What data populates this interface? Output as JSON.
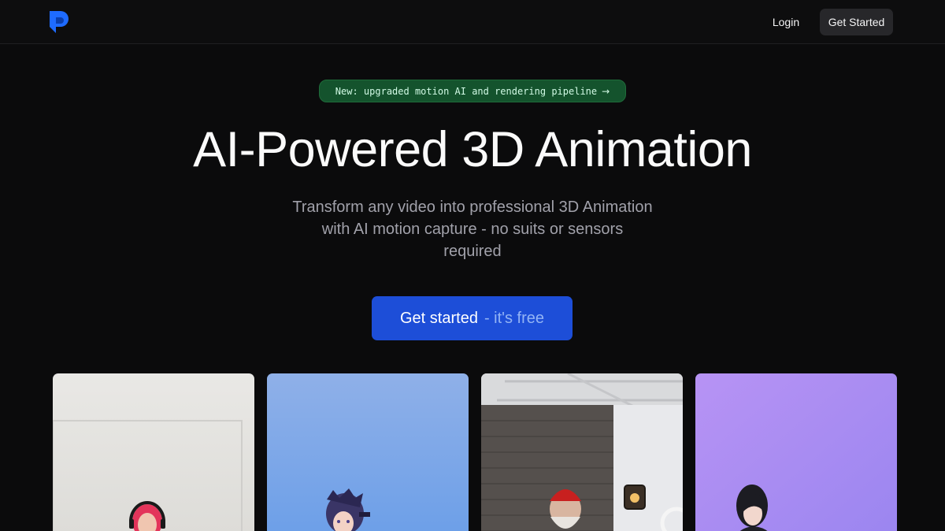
{
  "nav": {
    "logo_icon": "p-logo-icon",
    "login_label": "Login",
    "cta_label": "Get Started"
  },
  "announcement": {
    "text": "New: upgraded motion AI and rendering pipeline",
    "arrow_icon": "arrow-right-icon"
  },
  "hero": {
    "title": "AI-Powered 3D Animation",
    "subtitle": "Transform any video into professional 3D Animation with AI motion capture - no suits or sensors required"
  },
  "cta": {
    "main_label": "Get started",
    "sub_label": "- it's free"
  },
  "colors": {
    "background": "#0b0b0c",
    "accent": "#1d4ed8",
    "badge": "#14532d",
    "logo": "#1e6bff"
  },
  "gallery": [
    {
      "kind": "video-person-headphones"
    },
    {
      "kind": "avatar-anime-girl"
    },
    {
      "kind": "video-person-red-hat"
    },
    {
      "kind": "avatar-anime-boy"
    }
  ]
}
